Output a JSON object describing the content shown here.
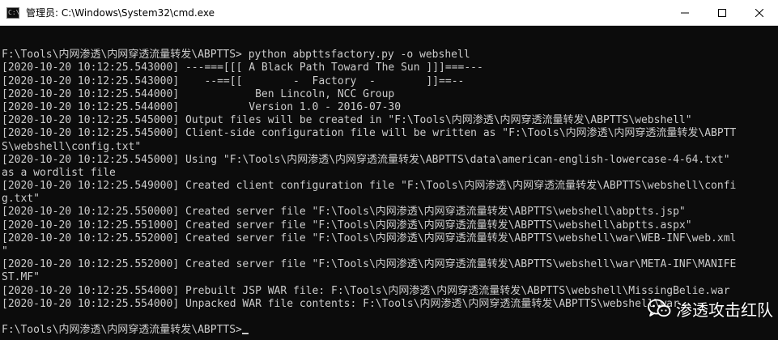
{
  "window": {
    "title": "管理员: C:\\Windows\\System32\\cmd.exe",
    "icon": "cmd-icon",
    "app_icon_glyph": "C:\\",
    "controls": {
      "minimize": "minimize-icon",
      "maximize": "maximize-icon",
      "close": "close-icon"
    }
  },
  "console": {
    "lines": [
      "",
      "F:\\Tools\\内网渗透\\内网穿透流量转发\\ABPTTS> python abpttsfactory.py -o webshell",
      "[2020-10-20 10:12:25.543000] ---===[[[ A Black Path Toward The Sun ]]]===---",
      "[2020-10-20 10:12:25.543000]    --==[[        -  Factory  -        ]]==--",
      "[2020-10-20 10:12:25.544000]            Ben Lincoln, NCC Group",
      "[2020-10-20 10:12:25.544000]           Version 1.0 - 2016-07-30",
      "[2020-10-20 10:12:25.545000] Output files will be created in \"F:\\Tools\\内网渗透\\内网穿透流量转发\\ABPTTS\\webshell\"",
      "[2020-10-20 10:12:25.545000] Client-side configuration file will be written as \"F:\\Tools\\内网渗透\\内网穿透流量转发\\ABPTT",
      "S\\webshell\\config.txt\"",
      "[2020-10-20 10:12:25.545000] Using \"F:\\Tools\\内网渗透\\内网穿透流量转发\\ABPTTS\\data\\american-english-lowercase-4-64.txt\"",
      "as a wordlist file",
      "[2020-10-20 10:12:25.549000] Created client configuration file \"F:\\Tools\\内网渗透\\内网穿透流量转发\\ABPTTS\\webshell\\confi",
      "g.txt\"",
      "[2020-10-20 10:12:25.550000] Created server file \"F:\\Tools\\内网渗透\\内网穿透流量转发\\ABPTTS\\webshell\\abptts.jsp\"",
      "[2020-10-20 10:12:25.551000] Created server file \"F:\\Tools\\内网渗透\\内网穿透流量转发\\ABPTTS\\webshell\\abptts.aspx\"",
      "[2020-10-20 10:12:25.552000] Created server file \"F:\\Tools\\内网渗透\\内网穿透流量转发\\ABPTTS\\webshell\\war\\WEB-INF\\web.xml",
      "\"",
      "[2020-10-20 10:12:25.552000] Created server file \"F:\\Tools\\内网渗透\\内网穿透流量转发\\ABPTTS\\webshell\\war\\META-INF\\MANIFE",
      "ST.MF\"",
      "[2020-10-20 10:12:25.554000] Prebuilt JSP WAR file: F:\\Tools\\内网渗透\\内网穿透流量转发\\ABPTTS\\webshell\\MissingBelie.war",
      "[2020-10-20 10:12:25.554000] Unpacked WAR file contents: F:\\Tools\\内网渗透\\内网穿透流量转发\\ABPTTS\\webshell\\war",
      ""
    ],
    "prompt": "F:\\Tools\\内网渗透\\内网穿透流量转发\\ABPTTS>"
  },
  "watermark": {
    "text": "渗透攻击红队",
    "icon": "wechat-icon"
  },
  "colors": {
    "console_bg": "#0c0c0c",
    "console_fg": "#cccccc",
    "titlebar_bg": "#ffffff"
  }
}
